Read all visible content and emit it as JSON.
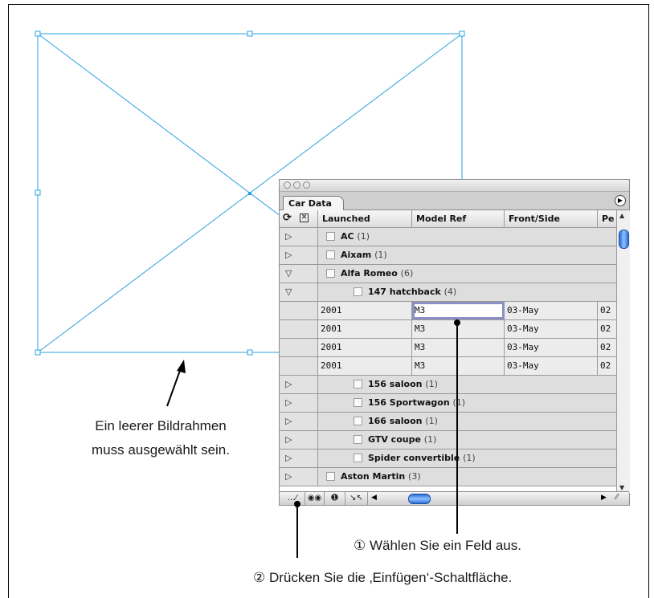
{
  "annotations": {
    "frame_caption_line1": "Ein leerer Bildrahmen",
    "frame_caption_line2": "muss ausgewählt sein.",
    "step1": "① Wählen Sie ein Feld aus.",
    "step2": "② Drücken Sie die ‚Einfügen‘-Schaltfläche."
  },
  "panel": {
    "tab_label": "Car Data",
    "columns": [
      "Launched",
      "Model Ref",
      "Front/Side",
      "Pe"
    ],
    "rows": [
      {
        "type": "group",
        "expanded": false,
        "indent": 0,
        "label": "AC",
        "count": "(1)"
      },
      {
        "type": "group",
        "expanded": false,
        "indent": 0,
        "label": "Aixam",
        "count": "(1)"
      },
      {
        "type": "group",
        "expanded": true,
        "indent": 0,
        "label": "Alfa Romeo",
        "count": "(6)"
      },
      {
        "type": "group",
        "expanded": true,
        "indent": 1,
        "label": "147 hatchback",
        "count": "(4)"
      },
      {
        "type": "data",
        "cells": [
          "2001",
          "M3",
          "03-May",
          "02"
        ],
        "selected_col": 1
      },
      {
        "type": "data",
        "cells": [
          "2001",
          "M3",
          "03-May",
          "02"
        ]
      },
      {
        "type": "data",
        "cells": [
          "2001",
          "M3",
          "03-May",
          "02"
        ]
      },
      {
        "type": "data",
        "cells": [
          "2001",
          "M3",
          "03-May",
          "02"
        ]
      },
      {
        "type": "group",
        "expanded": false,
        "indent": 1,
        "label": "156 saloon",
        "count": "(1)"
      },
      {
        "type": "group",
        "expanded": false,
        "indent": 1,
        "label": "156 Sportwagon",
        "count": "(1)"
      },
      {
        "type": "group",
        "expanded": false,
        "indent": 1,
        "label": "166 saloon",
        "count": "(1)"
      },
      {
        "type": "group",
        "expanded": false,
        "indent": 1,
        "label": "GTV coupe",
        "count": "(1)"
      },
      {
        "type": "group",
        "expanded": false,
        "indent": 1,
        "label": "Spider convertible",
        "count": "(1)"
      },
      {
        "type": "group",
        "expanded": false,
        "indent": 0,
        "label": "Aston Martin",
        "count": "(3)"
      }
    ],
    "bottom_buttons": [
      "place-icon",
      "binoculars-icon",
      "info-icon",
      "collapse-icon"
    ]
  },
  "colors": {
    "frame_line": "#2aa2e0",
    "selection_outline": "#8a8fc4",
    "scroll_thumb": "#2d6fd6"
  }
}
